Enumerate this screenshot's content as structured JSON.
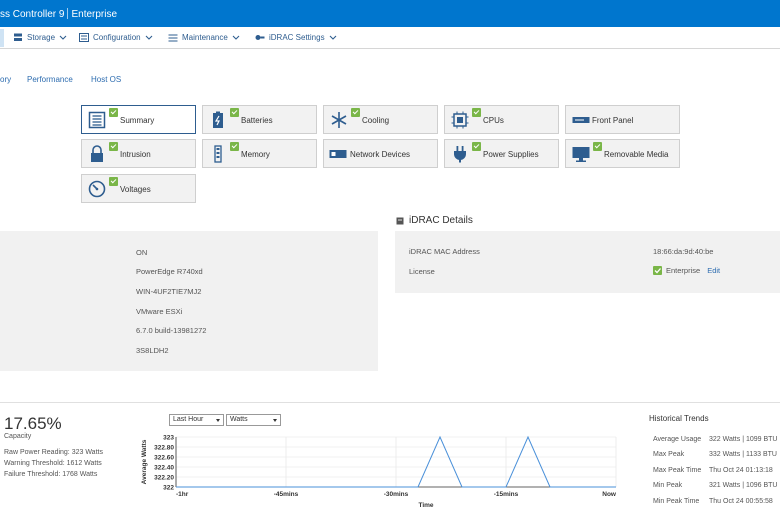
{
  "header": {
    "title_left": "ss Controller 9",
    "title_right": "Enterprise"
  },
  "menu": {
    "items": [
      {
        "label": "Storage",
        "icon": "storage-icon"
      },
      {
        "label": "Configuration",
        "icon": "configuration-icon"
      },
      {
        "label": "Maintenance",
        "icon": "maintenance-icon"
      },
      {
        "label": "iDRAC Settings",
        "icon": "idrac-settings-icon"
      }
    ]
  },
  "subtabs": [
    "ory",
    "Performance",
    "Host OS"
  ],
  "tiles": [
    {
      "label": "Summary",
      "icon": "summary-icon",
      "active": true
    },
    {
      "label": "Batteries",
      "icon": "battery-icon"
    },
    {
      "label": "Cooling",
      "icon": "snowflake-icon"
    },
    {
      "label": "CPUs",
      "icon": "cpu-icon"
    },
    {
      "label": "Front Panel",
      "icon": "front-panel-icon"
    },
    {
      "label": "Intrusion",
      "icon": "lock-icon"
    },
    {
      "label": "Memory",
      "icon": "memory-icon"
    },
    {
      "label": "Network Devices",
      "icon": "network-card-icon"
    },
    {
      "label": "Power Supplies",
      "icon": "power-plug-icon"
    },
    {
      "label": "Removable Media",
      "icon": "monitor-icon"
    },
    {
      "label": "Voltages",
      "icon": "gauge-icon"
    }
  ],
  "system_values": [
    "ON",
    "PowerEdge R740xd",
    "WIN-4UF2TIE7MJ2",
    "VMware ESXi",
    "6.7.0 build-13981272",
    "3S8LDH2"
  ],
  "idrac": {
    "title": "iDRAC Details",
    "mac_label": "iDRAC MAC Address",
    "mac_value": "18:66:da:9d:40:be",
    "license_label": "License",
    "license_value": "Enterprise",
    "edit_link": "Edit"
  },
  "power": {
    "percent": "17.65%",
    "capacity_label": "Capacity",
    "lines": [
      "Raw Power Reading: 323 Watts",
      "Warning Threshold: 1612 Watts",
      "Failure Threshold: 1768 Watts"
    ]
  },
  "selects": {
    "range": "Last Hour",
    "unit": "Watts"
  },
  "chart_data": {
    "type": "line",
    "title": "",
    "xlabel": "Time",
    "ylabel": "Average Watts",
    "x_ticks": [
      "-1hr",
      "-45mins",
      "-30mins",
      "-15mins",
      "Now"
    ],
    "y_ticks": [
      "323",
      "322.80",
      "322.60",
      "322.40",
      "322.20",
      "322"
    ],
    "ylim": [
      322,
      323
    ],
    "x": [
      -60,
      -30,
      -27,
      -24,
      -21,
      -15,
      -12,
      -9,
      -3,
      0
    ],
    "series": [
      {
        "values": [
          322,
          322,
          322,
          323,
          322,
          322,
          323,
          322,
          322,
          322
        ],
        "color": "#4a90d9"
      }
    ],
    "grid": true
  },
  "trends": {
    "title": "Historical Trends",
    "rows": [
      {
        "label": "Average Usage",
        "value": "322 Watts | 1099 BTU"
      },
      {
        "label": "Max Peak",
        "value": "332 Watts | 1133 BTU"
      },
      {
        "label": "Max Peak Time",
        "value": "Thu Oct 24 01:13:18"
      },
      {
        "label": "Min Peak",
        "value": "321 Watts | 1096 BTU"
      },
      {
        "label": "Min Peak Time",
        "value": "Thu Oct 24 00:55:58"
      }
    ]
  },
  "colors": {
    "brand": "#0076ce",
    "link": "#2e6db0",
    "ok": "#7ab648",
    "panel": "#f1f1f1"
  }
}
